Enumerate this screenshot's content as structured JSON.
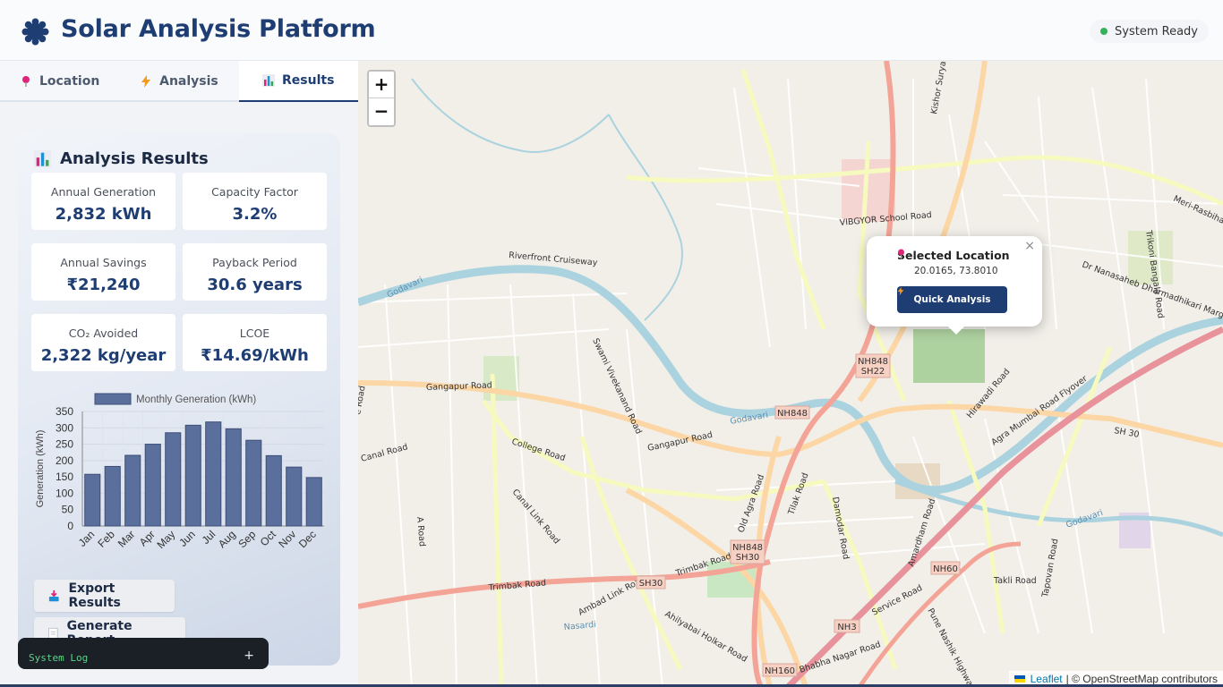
{
  "header": {
    "title": "Solar Analysis Platform",
    "logo_icon": "sun-gear-icon",
    "status_text": "System Ready",
    "status_color": "#34b25a"
  },
  "tabs": [
    {
      "label": "Location",
      "icon": "pin-icon",
      "active": false
    },
    {
      "label": "Analysis",
      "icon": "bolt-icon",
      "active": false
    },
    {
      "label": "Results",
      "icon": "bar-chart-icon",
      "active": true
    }
  ],
  "results": {
    "title": "Analysis Results",
    "metrics": [
      {
        "label": "Annual Generation",
        "value": "2,832 kWh"
      },
      {
        "label": "Capacity Factor",
        "value": "3.2%"
      },
      {
        "label": "Annual Savings",
        "value": "₹21,240"
      },
      {
        "label": "Payback Period",
        "value": "30.6 years"
      },
      {
        "label": "CO₂ Avoided",
        "value": "2,322 kg/year"
      },
      {
        "label": "LCOE",
        "value": "₹14.69/kWh"
      }
    ],
    "export_label": "Export Results",
    "report_label": "Generate Report"
  },
  "chart_data": {
    "type": "bar",
    "categories": [
      "Jan",
      "Feb",
      "Mar",
      "Apr",
      "May",
      "Jun",
      "Jul",
      "Aug",
      "Sep",
      "Oct",
      "Nov",
      "Dec"
    ],
    "series": [
      {
        "name": "Monthly Generation (kWh)",
        "values": [
          158,
          182,
          216,
          250,
          285,
          308,
          318,
          297,
          262,
          215,
          180,
          148
        ]
      }
    ],
    "xlabel": "",
    "ylabel": "Generation (kWh)",
    "ylim": [
      0,
      350
    ],
    "yticks": [
      0,
      50,
      100,
      150,
      200,
      250,
      300,
      350
    ],
    "grid": true,
    "legend": "top",
    "bar_color": "#5a6f9c"
  },
  "syslog": {
    "label": "System Log",
    "toggle": "+"
  },
  "map": {
    "zoom_in": "+",
    "zoom_out": "−",
    "popup": {
      "title": "Selected Location",
      "coords": "20.0165, 73.8010",
      "button": "Quick Analysis",
      "close": "×"
    },
    "attribution": {
      "leaflet": "Leaflet",
      "rest": "| © OpenStreetMap contributors"
    },
    "labels": {
      "godavari": "Godavari",
      "riverfront": "Riverfront Cruiseway",
      "vibgyor": "VIBGYOR School Road",
      "gangapur": "Gangapur Road",
      "gangapur2": "Gangapur Road",
      "college": "College Road",
      "canal_link": "Canal Link Road",
      "trimbak": "Trimbak Road",
      "trimbak2": "Trimbak Road",
      "agra_mumbai": "Agra Mumbai Road Flyover",
      "nanasaheb": "Dr Nanasaheb Dharmadhikari Marg",
      "swami": "Swami Vivekanand Road",
      "old_agra": "Old Agra Road",
      "tilak": "Tilak Road",
      "damodar": "Damodar Road",
      "hirawadi": "Hirawadi Road",
      "ambad": "Ambad Link Road",
      "ahilyabai": "Ahilyabai Holkar Road",
      "bhabha": "Bhabha Nagar Road",
      "amardham": "Amardham Road",
      "pune_nashik": "Pune Nashik Highway",
      "takli": "Takli Road",
      "tapovan": "Tapovan Road",
      "meri": "Meri-Rasbihari",
      "trikoni": "Trikoni Bangala Road",
      "nasardi": "Nasardi",
      "sh30": "SH 30",
      "service": "Service Road",
      "kishor": "Kishor Suryawanshi",
      "a_road": "A Road",
      "nh848": "NH848",
      "sh22": "SH22",
      "sh30b": "SH30",
      "nh60": "NH60",
      "nh3": "NH3",
      "nh160": "NH160",
      "canal_rd": "Canal Road",
      "e_road": "e Road"
    }
  }
}
